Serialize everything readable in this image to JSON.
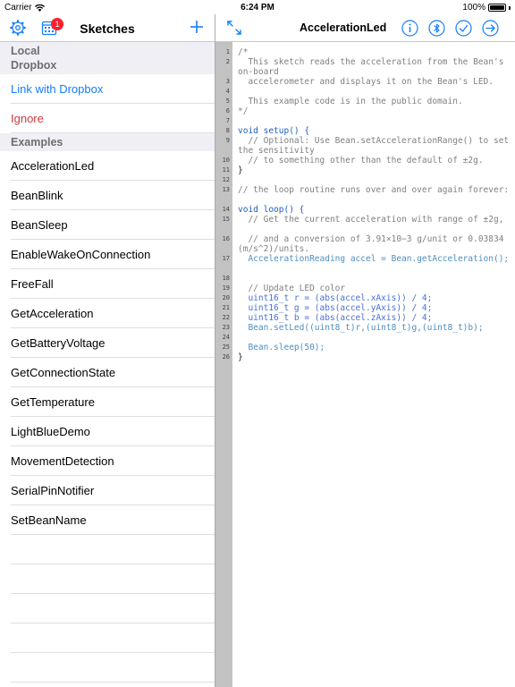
{
  "status_bar": {
    "carrier": "Carrier",
    "time": "6:24 PM",
    "battery": "100%"
  },
  "left_nav": {
    "title": "Sketches",
    "badge": "1"
  },
  "local_section": {
    "header_line1": "Local",
    "header_line2": "Dropbox"
  },
  "dropbox": {
    "link_label": "Link with Dropbox",
    "ignore_label": "Ignore"
  },
  "examples_header": "Examples",
  "examples": [
    "AccelerationLed",
    "BeanBlink",
    "BeanSleep",
    "EnableWakeOnConnection",
    "FreeFall",
    "GetAcceleration",
    "GetBatteryVoltage",
    "GetConnectionState",
    "GetTemperature",
    "LightBlueDemo",
    "MovementDetection",
    "SerialPinNotifier",
    "SetBeanName"
  ],
  "right_nav": {
    "title": "AccelerationLed"
  },
  "icons": {
    "settings": "gear-icon",
    "sketches": "calendar-grid-icon",
    "add": "plus-icon",
    "expand": "expand-arrows-icon",
    "info": "info-icon",
    "bluetooth": "bluetooth-icon",
    "verify": "checkmark-icon",
    "upload": "arrow-right-icon"
  },
  "colors": {
    "tint": "#157efb",
    "destructive": "#d0393e",
    "badge": "#ff1f2a",
    "gutter": "#c2c2c2"
  },
  "code": {
    "line_numbers": [
      "1",
      "2",
      "3",
      "4",
      "5",
      "6",
      "7",
      "8",
      "9",
      "10",
      "11",
      "12",
      "13",
      "14",
      "15",
      "16",
      "17",
      "18",
      "19",
      "20",
      "21",
      "22",
      "23",
      "24",
      "25",
      "26"
    ],
    "lines": [
      "/*",
      "  This sketch reads the acceleration from the Bean's on-board",
      "  accelerometer and displays it on the Bean's LED.",
      "",
      "  This example code is in the public domain.",
      "*/",
      "",
      "void setup() {",
      "  // Optional: Use Bean.setAccelerationRange() to set the sensitivity",
      "  // to something other than the default of ±2g.",
      "}",
      "",
      "// the loop routine runs over and over again forever:",
      "void loop() {",
      "  // Get the current acceleration with range of ±2g,",
      "  // and a conversion of 3.91×10−3 g/unit or 0.03834(m/s^2)/units.",
      "  AccelerationReading accel = Bean.getAcceleration();",
      "",
      "  // Update LED color",
      "  uint16_t r = (abs(accel.xAxis)) / 4;",
      "  uint16_t g = (abs(accel.yAxis)) / 4;",
      "  uint16_t b = (abs(accel.zAxis)) / 4;",
      "  Bean.setLed((uint8_t)r,(uint8_t)g,(uint8_t)b);",
      "",
      "  Bean.sleep(50);",
      "}"
    ]
  }
}
